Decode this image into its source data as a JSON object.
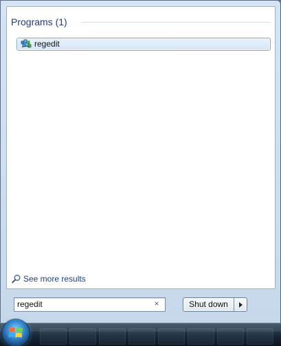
{
  "start_menu": {
    "results_header": "Programs (1)",
    "results": [
      {
        "label": "regedit",
        "icon": "regedit-icon"
      }
    ],
    "see_more": {
      "label": "See more results",
      "icon": "search-icon"
    },
    "search": {
      "value": "regedit",
      "clear_label": "×"
    },
    "power": {
      "shutdown_label": "Shut down",
      "menu_icon": "triangle-right-icon"
    }
  },
  "taskbar": {
    "start_icon": "windows-logo-icon"
  },
  "colors": {
    "selection_border": "#7aa7d7",
    "selection_fill": "#d4e6f8",
    "link_text": "#1c3f86",
    "header_text": "#1f3a7a"
  }
}
